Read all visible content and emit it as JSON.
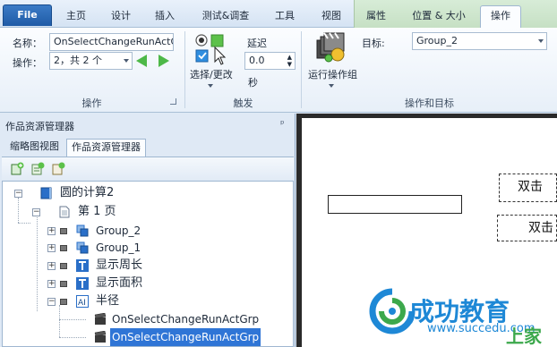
{
  "tabs": {
    "file": "File",
    "home": "主页",
    "design": "设计",
    "insert": "插入",
    "test_debug": "测试&调查",
    "tools": "工具",
    "view": "视图",
    "properties": "属性",
    "position_size": "位置 & 大小",
    "actions": "操作"
  },
  "ribbon": {
    "name_label": "名称：",
    "name_value": "OnSelectChangeRunActG",
    "operation_label": "操作：",
    "operation_value": "2，共 2 个",
    "group_operation": "操作",
    "select_change_label": "选择/更改",
    "delay_label": "延迟",
    "delay_value": "0.0",
    "seconds_label": "秒",
    "group_trigger": "触发",
    "run_group_label": "运行操作组",
    "target_label": "目标:",
    "target_value": "Group_2",
    "group_operation_target": "操作和目标"
  },
  "panel": {
    "title": "作品资源管理器",
    "pin": "ᵖ",
    "tab_thumbnail": "缩略图视图",
    "tab_explorer": "作品资源管理器",
    "tree": {
      "root": "圆的计算2",
      "page": "第 1 页",
      "group2": "Group_2",
      "group1": "Group_1",
      "show_perimeter": "显示周长",
      "show_area": "显示面积",
      "radius": "半径",
      "action1": "OnSelectChangeRunActGrp",
      "action2": "OnSelectChangeRunActGrp"
    }
  },
  "canvas": {
    "box1_text": "双击",
    "box2_text": "双击"
  },
  "watermark": {
    "brand": "成功教育",
    "url": "www.succedu.com",
    "corner": "上家"
  },
  "colors": {
    "accent": "#2f75d6",
    "file_tab": "#1f5ba6",
    "context_tab": "#c6e0c4",
    "watermark_blue": "#1e88d6",
    "watermark_green": "#3ca84c"
  }
}
